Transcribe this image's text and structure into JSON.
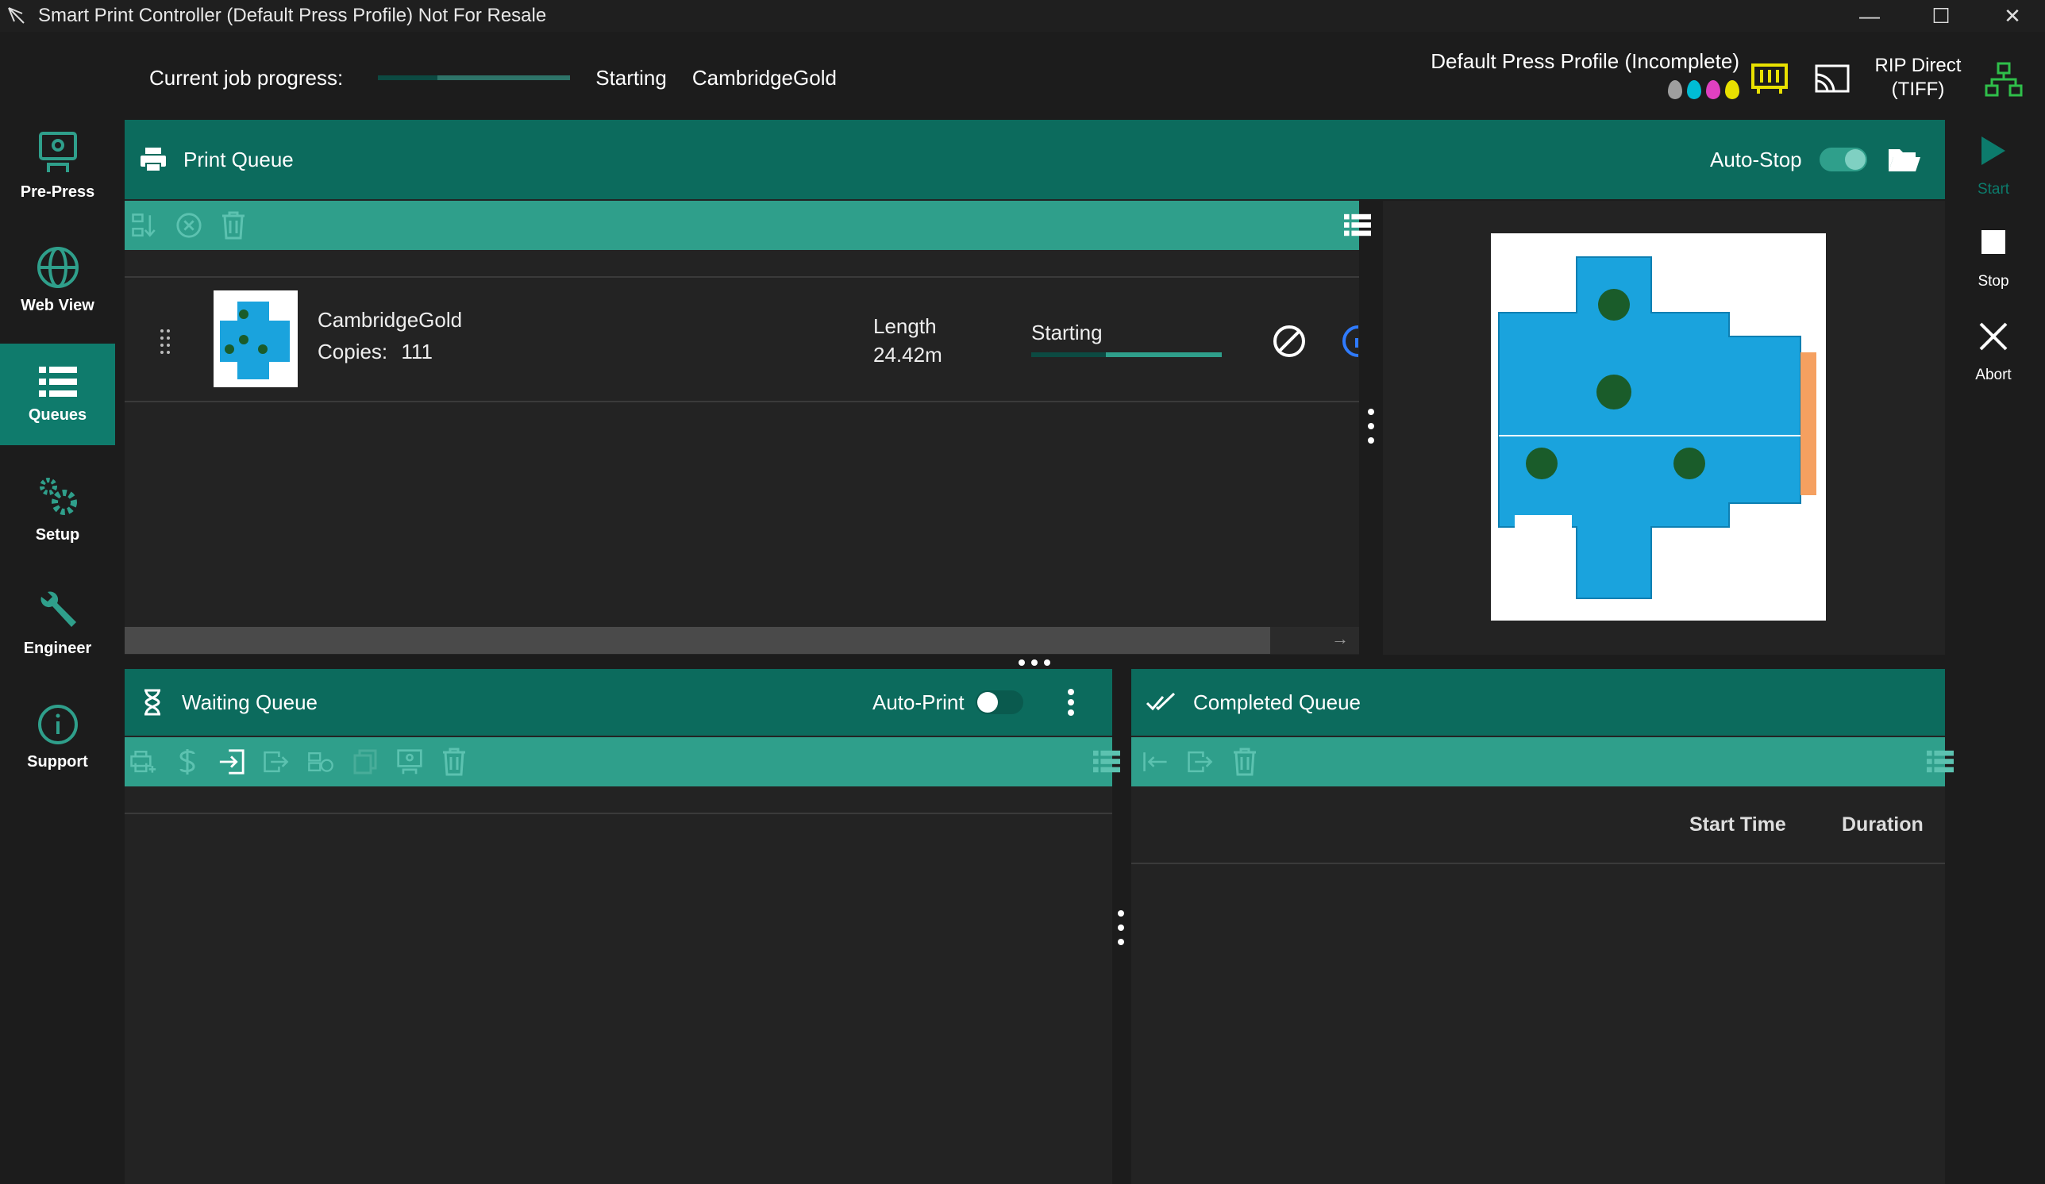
{
  "window": {
    "title": "Smart Print Controller (Default Press Profile) Not For Resale",
    "minimize": "—",
    "maximize": "☐",
    "close": "✕"
  },
  "nav": [
    {
      "label": "Pre-Press",
      "icon": "pre-press-icon"
    },
    {
      "label": "Web View",
      "icon": "globe-icon"
    },
    {
      "label": "Queues",
      "icon": "list-icon",
      "active": true
    },
    {
      "label": "Setup",
      "icon": "gears-icon"
    },
    {
      "label": "Engineer",
      "icon": "wrench-icon"
    },
    {
      "label": "Support",
      "icon": "info-icon"
    }
  ],
  "progress": {
    "label": "Current job progress:",
    "fraction": 0.31,
    "status": "Starting",
    "job": "CambridgeGold"
  },
  "profile": {
    "name": "Default Press Profile (Incomplete)",
    "rip_line1": "RIP Direct",
    "rip_line2": "(TIFF)",
    "ink_colors": [
      "#9e9e9e",
      "#00bcd4",
      "#e040c0",
      "#e8e000"
    ]
  },
  "print_queue": {
    "title": "Print Queue",
    "autostop_label": "Auto-Stop",
    "autostop_on": true
  },
  "job": {
    "name": "CambridgeGold",
    "copies_label": "Copies:",
    "copies": "111",
    "length_label": "Length",
    "length": "24.42m",
    "status": "Starting",
    "progress_fraction": 0.39
  },
  "waiting_queue": {
    "title": "Waiting Queue",
    "autoprint_label": "Auto-Print",
    "autoprint_on": false
  },
  "completed_queue": {
    "title": "Completed Queue",
    "col_start": "Start Time",
    "col_duration": "Duration"
  },
  "controls": {
    "start": "Start",
    "stop": "Stop",
    "abort": "Abort"
  },
  "colors": {
    "accent": "#0c6b5d",
    "toolbar": "#2f9f8b",
    "active_nav": "#0f7b6c",
    "bg": "#1c1c1c",
    "panel": "#232323"
  }
}
